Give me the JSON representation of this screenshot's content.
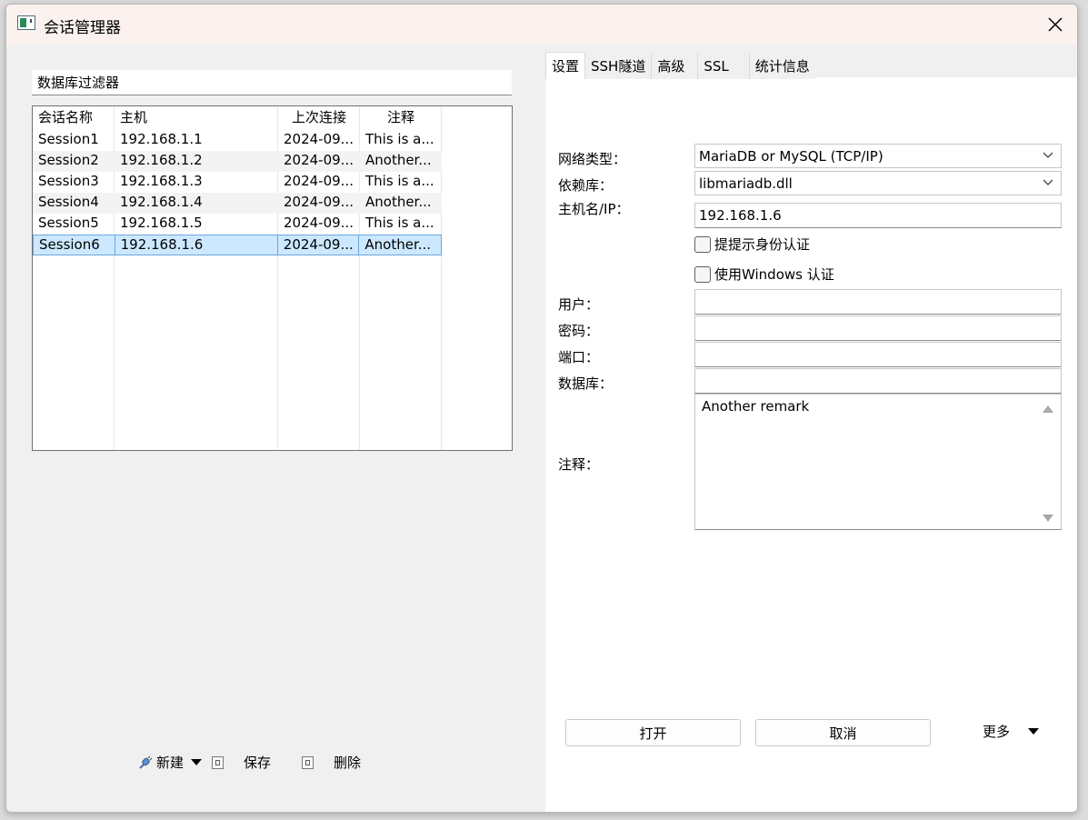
{
  "window": {
    "title": "会话管理器"
  },
  "filter": {
    "placeholder": "数据库过滤器"
  },
  "table": {
    "headers": [
      "会话名称",
      "主机",
      "上次连接",
      "注释"
    ],
    "rows": [
      [
        "Session1",
        "192.168.1.1",
        "2024-09...",
        "This is a..."
      ],
      [
        "Session2",
        "192.168.1.2",
        "2024-09...",
        "Another..."
      ],
      [
        "Session3",
        "192.168.1.3",
        "2024-09...",
        "This is a..."
      ],
      [
        "Session4",
        "192.168.1.4",
        "2024-09...",
        "Another..."
      ],
      [
        "Session5",
        "192.168.1.5",
        "2024-09...",
        "This is a..."
      ],
      [
        "Session6",
        "192.168.1.6",
        "2024-09...",
        "Another..."
      ]
    ],
    "selected_row": "Session6"
  },
  "bottom": {
    "new_label": "新建",
    "save_label": "保存",
    "delete_label": "删除"
  },
  "tabs": [
    "设置",
    "SSH隧道",
    "高级",
    "SSL",
    "统计信息"
  ],
  "form": {
    "network_type_label": "网络类型：",
    "network_type_value": "MariaDB or MySQL (TCP/IP)",
    "library_label": "依赖库：",
    "library_value": "libmariadb.dll",
    "host_label": "主机名/IP：",
    "host_value": "192.168.1.6",
    "prompt_auth_label": "提提示身份认证",
    "windows_auth_label": "使用Windows 认证",
    "user_label": "用户：",
    "password_label": "密码：",
    "port_label": "端口：",
    "database_label": "数据库：",
    "remark_label": "注释：",
    "remark_value": "Another remark"
  },
  "actions": {
    "open_label": "打开",
    "cancel_label": "取消",
    "more_label": "更多"
  }
}
